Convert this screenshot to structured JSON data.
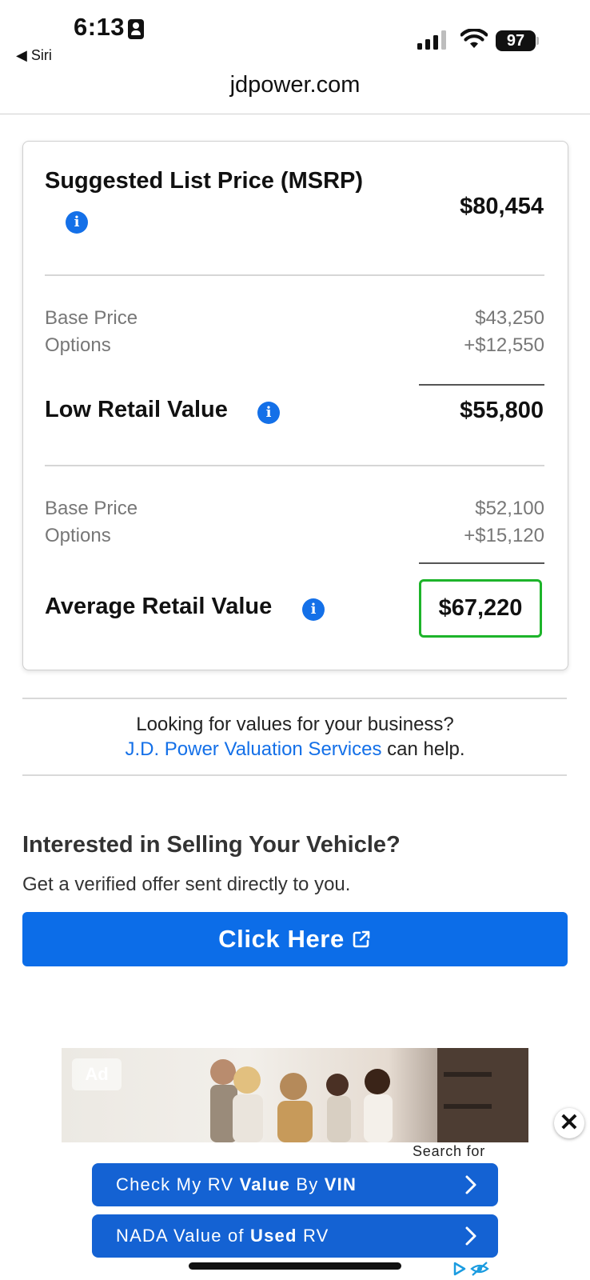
{
  "status_bar": {
    "time": "6:13",
    "back_label": "◀ Siri",
    "battery": "97"
  },
  "browser": {
    "url": "jdpower.com"
  },
  "pricing": {
    "msrp": {
      "label": "Suggested List Price (MSRP)",
      "value": "$80,454"
    },
    "low_breakdown": {
      "base_label": "Base Price",
      "base_value": "$43,250",
      "options_label": "Options",
      "options_value": "+$12,550"
    },
    "low_retail": {
      "label": "Low Retail Value",
      "value": "$55,800"
    },
    "avg_breakdown": {
      "base_label": "Base Price",
      "base_value": "$52,100",
      "options_label": "Options",
      "options_value": "+$15,120"
    },
    "average_retail": {
      "label": "Average Retail Value",
      "value": "$67,220"
    },
    "highlight_color": "#1db42a"
  },
  "business": {
    "line1": "Looking for values for your business?",
    "link_text": "J.D. Power Valuation Services",
    "line2_suffix": " can help."
  },
  "selling": {
    "title": "Interested in Selling Your Vehicle?",
    "subtitle": "Get a verified offer sent directly to you.",
    "cta_label": "Click Here"
  },
  "ad": {
    "badge": "Ad",
    "close_icon": "close-icon",
    "search_for": "Search for",
    "buttons": [
      {
        "pre": "Check My RV ",
        "b1": "Value",
        "mid": " By ",
        "b2": "VIN"
      },
      {
        "pre": "NADA Value of ",
        "b1": "Used",
        "mid": " RV",
        "b2": ""
      }
    ]
  },
  "colors": {
    "accent": "#1470e8",
    "cta": "#0c6de8",
    "ad_button": "#1462d3"
  }
}
